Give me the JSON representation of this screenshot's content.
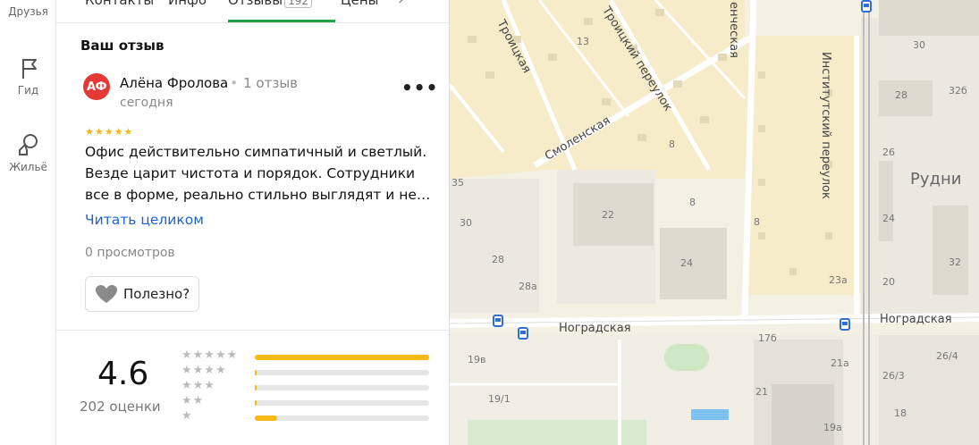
{
  "rail": {
    "friends": "Друзья",
    "guide": "Гид",
    "housing": "Жильё"
  },
  "tabs": [
    {
      "label": "Контакты"
    },
    {
      "label": "Инфо"
    },
    {
      "label": "Отзывы",
      "badge": "192"
    },
    {
      "label": "Цены"
    }
  ],
  "review_section": {
    "title": "Ваш отзыв",
    "avatar_initials": "АФ",
    "author": "Алёна Фролова",
    "author_reviews": "1 отзыв",
    "date": "сегодня",
    "stars": "★★★★★",
    "text": "Офис действительно симпатичный и светлый. Везде царит чистота и порядок. Сотрудники все в форме, реально стильно выглядят и не…",
    "read_more": "Читать целиком",
    "views": "0 просмотров",
    "useful": "Полезно?",
    "more": "•••"
  },
  "rating": {
    "value": "4.6",
    "count": "202 оценки",
    "distribution": [
      {
        "stars": "★★★★★",
        "fraction": 1.0
      },
      {
        "stars": "★★★★",
        "fraction": 0.01
      },
      {
        "stars": "★★★",
        "fraction": 0.01
      },
      {
        "stars": "★★",
        "fraction": 0.01
      },
      {
        "stars": "★",
        "fraction": 0.13
      }
    ]
  },
  "map": {
    "streets": {
      "troitskaya": "Троицкая",
      "troitsky_lane": "Троицкий переулок",
      "smolenskaya": "Смоленская",
      "institutsky_lane": "Институтский переулок",
      "nogradskaya_1": "Ноградская",
      "nogradskaya_2": "Ноградская",
      "entseskaya": "енческая"
    },
    "district": "Рудни",
    "houses": [
      "13",
      "30",
      "28",
      "32б",
      "26",
      "24",
      "22",
      "24",
      "8",
      "8",
      "8",
      "28",
      "28а",
      "30",
      "23а",
      "20",
      "32",
      "17б",
      "19в",
      "19/1",
      "21а",
      "26/4",
      "26/3",
      "21",
      "18",
      "19а",
      "35"
    ]
  },
  "colors": {
    "accent_green": "#22a34a",
    "star": "#f6b916",
    "link": "#1e64d0",
    "avatar": "#e53935"
  }
}
